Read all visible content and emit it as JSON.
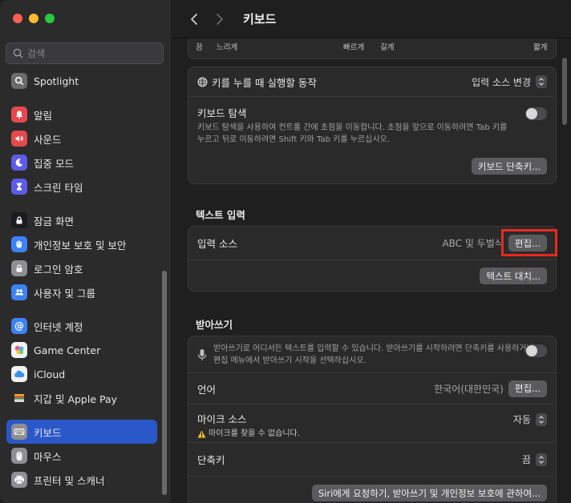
{
  "window": {
    "title": "키보드"
  },
  "sidebar": {
    "search_placeholder": "검색",
    "items": [
      {
        "label": "Spotlight",
        "icon": "magnifier-icon",
        "color": "#6b6b6b"
      },
      {
        "label": "알림",
        "icon": "bell-icon",
        "color": "#e5484d"
      },
      {
        "label": "사운드",
        "icon": "speaker-icon",
        "color": "#e5484d"
      },
      {
        "label": "집중 모드",
        "icon": "moon-icon",
        "color": "#5e5ce6"
      },
      {
        "label": "스크린 타임",
        "icon": "hourglass-icon",
        "color": "#5e5ce6"
      },
      {
        "label": "잠금 화면",
        "icon": "lock-screen-icon",
        "color": "#1c1c1e"
      },
      {
        "label": "개인정보 보호 및 보안",
        "icon": "hand-icon",
        "color": "#3b82f6"
      },
      {
        "label": "로그인 암호",
        "icon": "lock-icon",
        "color": "#8e8e93"
      },
      {
        "label": "사용자 및 그룹",
        "icon": "users-icon",
        "color": "#3b82f6"
      },
      {
        "label": "인터넷 계정",
        "icon": "at-icon",
        "color": "#3b82f6"
      },
      {
        "label": "Game Center",
        "icon": "game-center-icon",
        "color": "#f2f2f2"
      },
      {
        "label": "iCloud",
        "icon": "cloud-icon",
        "color": "#f2f2f2"
      },
      {
        "label": "지갑 및 Apple Pay",
        "icon": "wallet-icon",
        "color": "#2c2c2e"
      },
      {
        "label": "키보드",
        "icon": "keyboard-icon",
        "color": "#8e8e93"
      },
      {
        "label": "마우스",
        "icon": "mouse-icon",
        "color": "#8e8e93"
      },
      {
        "label": "프린터 및 스캐너",
        "icon": "printer-icon",
        "color": "#8e8e93"
      }
    ]
  },
  "slider_labels": {
    "a": "끔",
    "b": "느리게",
    "c": "빠르게",
    "d": "길게",
    "e": "짧게"
  },
  "keyboard_section": {
    "globe_label": "키를 누를 때 실행할 동작",
    "globe_value": "입력 소스 변경",
    "nav_label": "키보드 탐색",
    "nav_desc_1": "키보드 탐색을 사용하여 컨트롤 간에 초점을 이동합니다. 초점을 앞으로 이동하려면 Tab 키를",
    "nav_desc_2": "누르고 뒤로 이동하려면 Shift 키와 Tab 키를 누르십시오.",
    "shortcuts_button": "키보드 단축키..."
  },
  "text_input": {
    "title": "텍스트 입력",
    "input_sources_label": "입력 소스",
    "input_sources_value": "ABC 및 두벌식",
    "edit_button": "편집...",
    "replace_button": "텍스트 대치..."
  },
  "dictation": {
    "title": "받아쓰기",
    "desc_1": "받아쓰기로 어디서든 텍스트를 입력할 수 있습니다. 받아쓰기를 시작하려면 단축키를 사용하거나",
    "desc_2": "편집 메뉴에서 받아쓰기 시작을 선택하십시오.",
    "language_label": "언어",
    "language_value": "한국어(대한민국)",
    "language_edit": "편집...",
    "mic_label": "마이크 소스",
    "mic_value": "자동",
    "mic_warning": "마이크를 찾을 수 없습니다.",
    "shortcut_label": "단축키",
    "shortcut_value": "끔",
    "privacy_button": "Siri에게 요청하기, 받아쓰기 및 개인정보 보호에 관하여..."
  },
  "colors": {
    "highlight": "#e8291f",
    "active": "#2a58c8"
  }
}
